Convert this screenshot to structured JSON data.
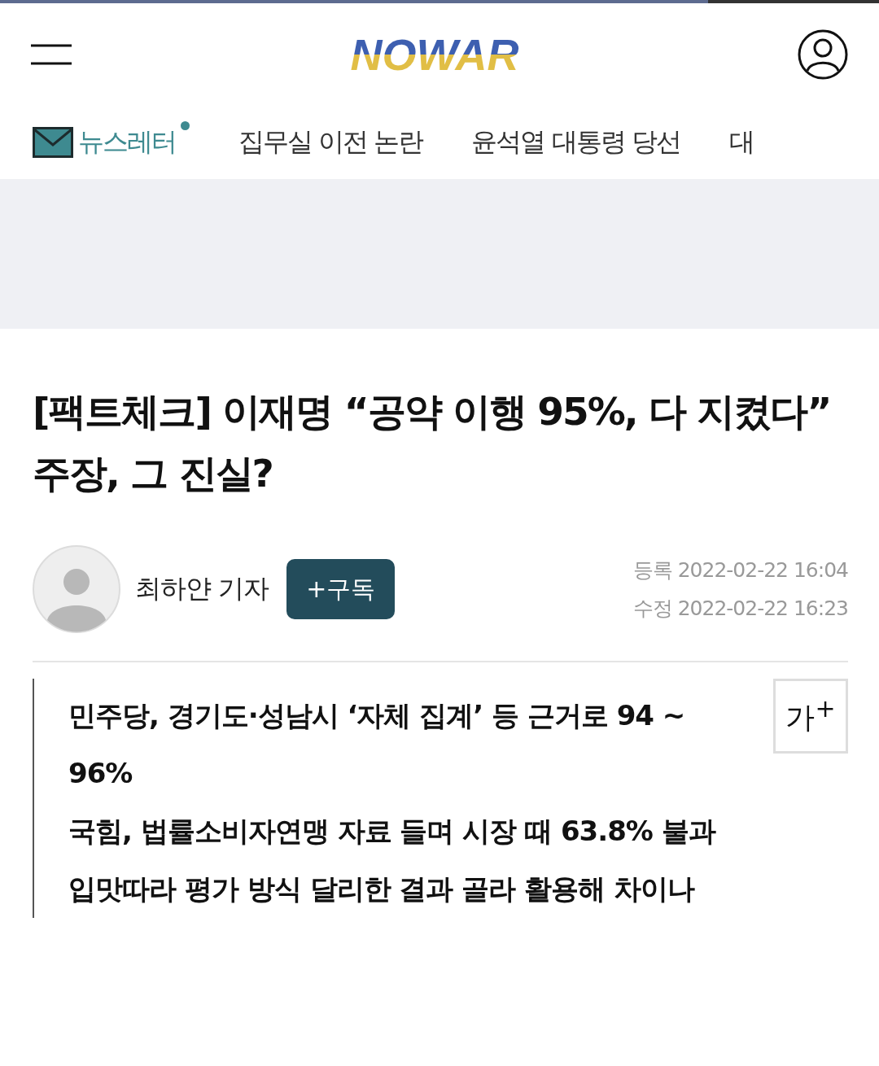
{
  "reading_progress": {
    "level": 0.806
  },
  "header": {
    "logo": "NOWAR"
  },
  "tabs": [
    {
      "label": "뉴스레터",
      "kind": "newsletter",
      "selected": true
    },
    {
      "label": "집무실 이전 논란",
      "kind": "topic",
      "selected": false
    },
    {
      "label": "윤석열 대통령 당선",
      "kind": "topic",
      "selected": false
    },
    {
      "label": "대",
      "kind": "topic",
      "selected": false
    }
  ],
  "article": {
    "title": "[팩트체크] 이재명 “공약 이행 95%, 다 지켰다” 주장, 그 진실?",
    "author": "최하얀 기자",
    "subscribe_button": "+구독",
    "registered": "등록 2022-02-22 16:04",
    "modified": "수정 2022-02-22 16:23",
    "font_size_button": "가$^{+}$",
    "summary": [
      "민주당, 경기도·성남시 ‘자체 집계’ 등 근거로 94 ~ 96%",
      "국힘, 법률소비자연맹 자료 들며 시장 때 63.8% 불과",
      "입맛따라 평가 방식 달리한 결과 골라 활용해 차이나"
    ]
  }
}
